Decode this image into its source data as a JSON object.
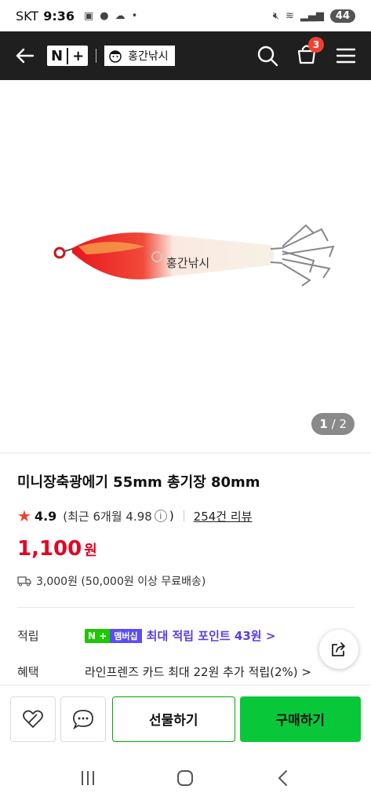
{
  "status": {
    "carrier": "SKT",
    "time": "9:36",
    "battery": "44"
  },
  "header": {
    "brand_n": "N",
    "brand_plus": "+",
    "store_name": "홍간낚시",
    "cart_count": "3"
  },
  "image": {
    "watermark": "홍간낚시",
    "current": "1",
    "total": "/ 2"
  },
  "product": {
    "title": "미니장축광에기 55mm 총기장 80mm",
    "rating": "4.9",
    "recent_rating": "(최근 6개월 4.98",
    "recent_rating_close": ")",
    "review_count": "254건 리뷰",
    "price": "1,100",
    "price_unit": "원",
    "shipping": "3,000원 (50,000원 이상 무료배송)"
  },
  "benefits": {
    "points_label": "적립",
    "membership_n": "N +",
    "membership_tag": "멤버십",
    "points_text": "최대 적립 포인트 43원 >",
    "benefit_label": "혜택",
    "benefit_text": "라인프렌즈 카드 최대 22원 추가 적립(2%) >"
  },
  "actions": {
    "gift": "선물하기",
    "buy": "구매하기"
  },
  "colors": {
    "header_bg": "#1f1f1f",
    "price_red": "#e60023",
    "buy_green": "#08c83a",
    "points_purple": "#5b3de6"
  }
}
